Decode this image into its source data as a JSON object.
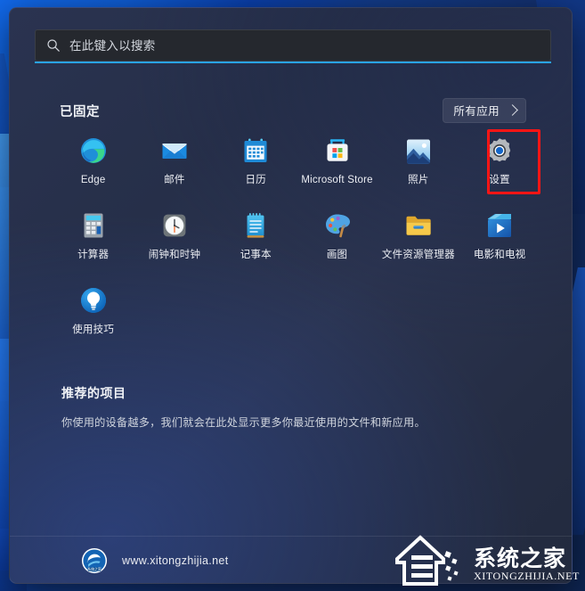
{
  "search": {
    "placeholder": "在此键入以搜索",
    "value": "",
    "icon": "search-icon",
    "accent_color": "#2aa3e8"
  },
  "pinned": {
    "title": "已固定",
    "all_apps_label": "所有应用",
    "all_apps_chevron": "chevron-right-icon",
    "apps": [
      {
        "label": "Edge",
        "icon": "edge-icon"
      },
      {
        "label": "邮件",
        "icon": "mail-icon"
      },
      {
        "label": "日历",
        "icon": "calendar-icon"
      },
      {
        "label": "Microsoft Store",
        "icon": "microsoft-store-icon"
      },
      {
        "label": "照片",
        "icon": "photos-icon"
      },
      {
        "label": "设置",
        "icon": "settings-gear-icon"
      },
      {
        "label": "计算器",
        "icon": "calculator-icon"
      },
      {
        "label": "闹钟和时钟",
        "icon": "alarms-clock-icon"
      },
      {
        "label": "记事本",
        "icon": "notepad-icon"
      },
      {
        "label": "画图",
        "icon": "paint-icon"
      },
      {
        "label": "文件资源管理器",
        "icon": "file-explorer-icon"
      },
      {
        "label": "电影和电视",
        "icon": "movies-tv-icon"
      },
      {
        "label": "使用技巧",
        "icon": "tips-lightbulb-icon"
      }
    ]
  },
  "highlight": {
    "target_label": "设置",
    "color": "#fc1515"
  },
  "recommended": {
    "title": "推荐的项目",
    "empty_message": "你使用的设备越多，我们就会在此处显示更多你最近使用的文件和新应用。"
  },
  "footer": {
    "logo": "xitongzhijia-round-logo",
    "url": "www.xitongzhijia.net"
  },
  "watermark": {
    "mark": "xitongzhijia-house-logo",
    "cn_text": "系统之家",
    "en_text": "XITONGZHIJIA.NET"
  }
}
